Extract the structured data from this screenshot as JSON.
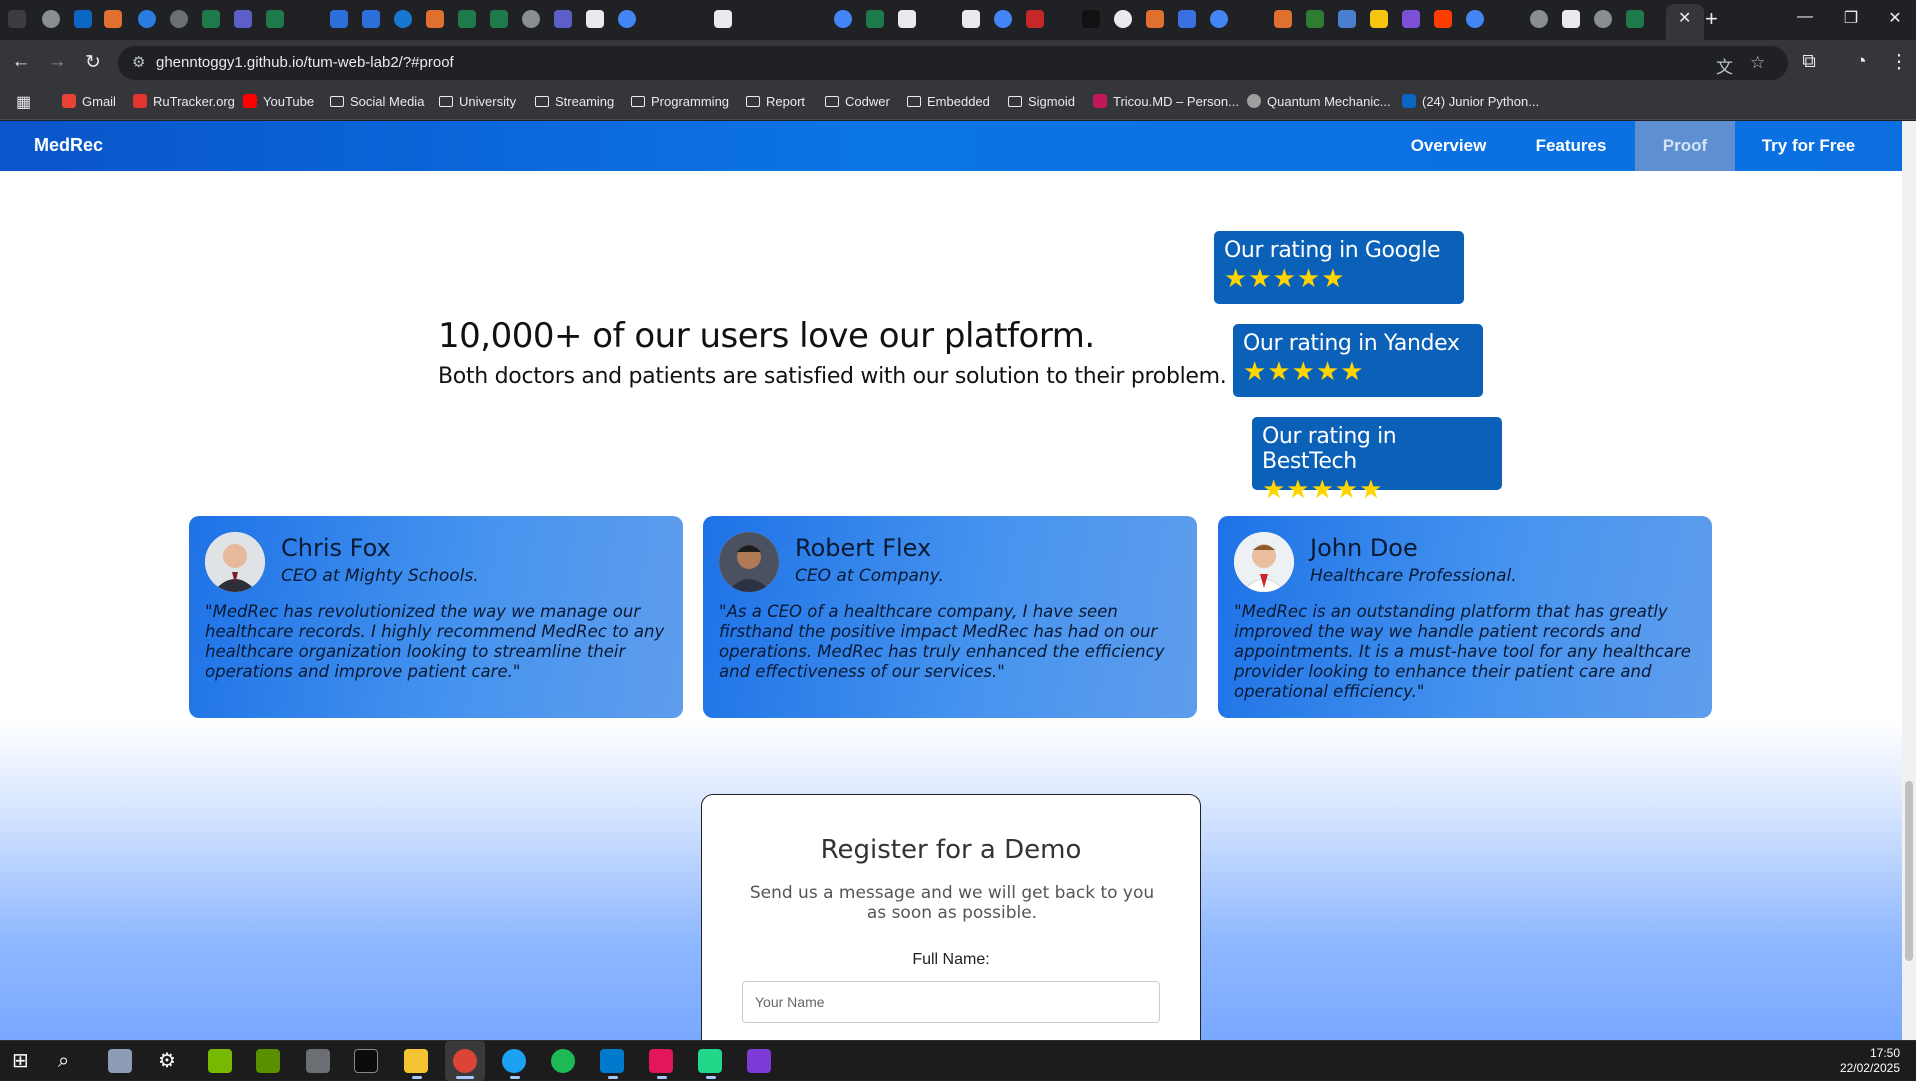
{
  "browser": {
    "url": "ghenntoggy1.github.io/tum-web-lab2/?#proof",
    "bookmarks": [
      {
        "label": "Gmail",
        "type": "site",
        "color": "#ea4335"
      },
      {
        "label": "RuTracker.org",
        "type": "site",
        "color": "#e3342f"
      },
      {
        "label": "YouTube",
        "type": "site",
        "color": "#ff0000"
      },
      {
        "label": "Social Media",
        "type": "folder"
      },
      {
        "label": "University",
        "type": "folder"
      },
      {
        "label": "Streaming",
        "type": "folder"
      },
      {
        "label": "Programming",
        "type": "folder"
      },
      {
        "label": "Report",
        "type": "folder"
      },
      {
        "label": "Codwer",
        "type": "folder"
      },
      {
        "label": "Embedded",
        "type": "folder"
      },
      {
        "label": "Sigmoid",
        "type": "folder"
      },
      {
        "label": "Tricou.MD – Person...",
        "type": "site",
        "color": "#c2185b"
      },
      {
        "label": "Quantum Mechanic...",
        "type": "site",
        "color": "#9e9e9e"
      },
      {
        "label": "(24) Junior Python...",
        "type": "site",
        "color": "#0a66c2"
      }
    ]
  },
  "navbar": {
    "brand": "MedRec",
    "links": [
      {
        "label": "Overview",
        "active": false
      },
      {
        "label": "Features",
        "active": false
      },
      {
        "label": "Proof",
        "active": true
      },
      {
        "label": "Try for Free",
        "active": false
      }
    ]
  },
  "proof": {
    "title": "10,000+ of our users love our platform.",
    "subtitle": "Both doctors and patients are satisfied with our solution to their problem.",
    "ratings": [
      {
        "title": "Our rating in Google",
        "stars": "★★★★★"
      },
      {
        "title": "Our rating in Yandex",
        "stars": "★★★★★"
      },
      {
        "title": "Our rating in BestTech",
        "stars": "★★★★★"
      }
    ]
  },
  "testimonials": [
    {
      "name": "Chris Fox",
      "role": "CEO at Mighty Schools.",
      "quote": "\"MedRec has revolutionized the way we manage our healthcare records. I highly recommend MedRec to any healthcare organization looking to streamline their operations and improve patient care.\""
    },
    {
      "name": "Robert Flex",
      "role": "CEO at Company.",
      "quote": "\"As a CEO of a healthcare company, I have seen firsthand the positive impact MedRec has had on our operations. MedRec has truly enhanced the efficiency and effectiveness of our services.\""
    },
    {
      "name": "John Doe",
      "role": "Healthcare Professional.",
      "quote": "\"MedRec is an outstanding platform that has greatly improved the way we handle patient records and appointments. It is a must-have tool for any healthcare provider looking to enhance their patient care and operational efficiency.\""
    }
  ],
  "demo": {
    "title": "Register for a Demo",
    "subtitle": "Send us a message and we will get back to you as soon as possible.",
    "name_label": "Full Name:",
    "name_placeholder": "Your Name"
  },
  "taskbar": {
    "time": "17:50",
    "date": "22/02/2025"
  },
  "colors": {
    "navbar": "#0b6fe0",
    "rating_box": "#0b60b8",
    "star": "#ffd500",
    "card": "#4593ef"
  }
}
